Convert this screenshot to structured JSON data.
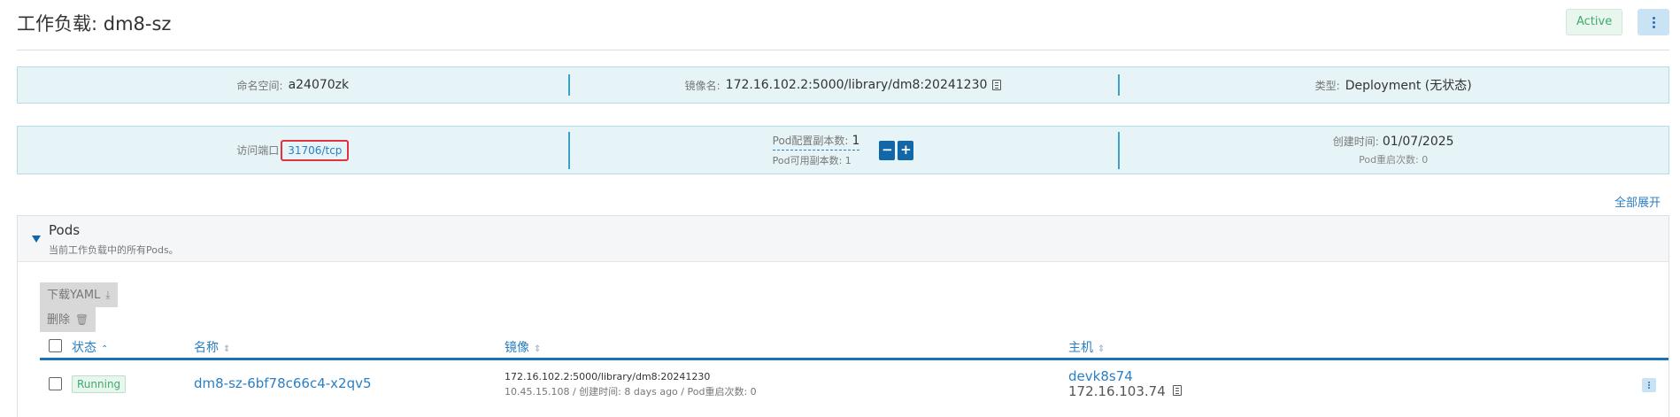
{
  "header": {
    "title": "工作负载: dm8-sz",
    "status": "Active"
  },
  "info1": {
    "namespace_label": "命名空间:",
    "namespace_value": "a24070zk",
    "image_label": "镜像名:",
    "image_value": "172.16.102.2:5000/library/dm8:20241230",
    "type_label": "类型:",
    "type_value": "Deployment (无状态)"
  },
  "info2": {
    "port_label": "访问端口",
    "port_value": "31706/tcp",
    "replica_label": "Pod配置副本数:",
    "replica_value": "1",
    "available_text": "Pod可用副本数: 1",
    "minus": "−",
    "plus": "+",
    "created_label": "创建时间:",
    "created_value": "01/07/2025",
    "restart_text": "Pod重启次数: 0"
  },
  "expand_all": "全部展开",
  "pods": {
    "title": "Pods",
    "description": "当前工作负载中的所有Pods。",
    "download_yaml": "下载YAML",
    "delete": "删除",
    "columns": {
      "status": "状态",
      "name": "名称",
      "image": "镜像",
      "host": "主机"
    },
    "rows": [
      {
        "status": "Running",
        "name": "dm8-sz-6bf78c66c4-x2qv5",
        "image": "172.16.102.2:5000/library/dm8:20241230",
        "meta": "10.45.15.108 / 创建时间: 8 days ago / Pod重启次数: 0",
        "host": "devk8s74",
        "host_ip": "172.16.103.74"
      }
    ]
  },
  "colors": {
    "accent": "#1167a8",
    "link": "#2a7fc4",
    "info_bg": "#e6f4f7",
    "running": "#3eaa6a",
    "highlight": "#e0323f"
  },
  "icons": [
    "kebab-icon",
    "copy-icon",
    "download-icon",
    "trash-icon",
    "sort-icon",
    "caret-down-icon"
  ]
}
